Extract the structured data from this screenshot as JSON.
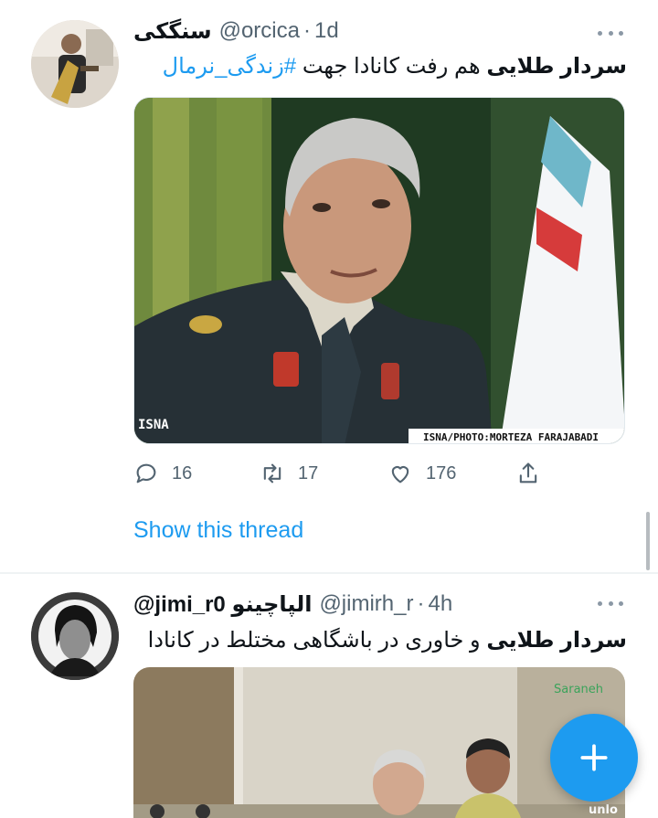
{
  "tweets": [
    {
      "display_name": "سنگکی",
      "handle": "@orcica",
      "separator": "·",
      "time": "1d",
      "text_bold": "سردار طلایی",
      "text_plain": " هم رفت کانادا جهت ",
      "hashtag": "#زندگی_نرمال",
      "media": {
        "watermark_left": "ISNA",
        "watermark_right": "ISNA/PHOTO:MORTEZA FARAJABADI"
      },
      "actions": {
        "reply_count": "16",
        "retweet_count": "17",
        "like_count": "176"
      },
      "show_thread": "Show this thread"
    },
    {
      "display_name": "@jimi_r0 الپاچینو",
      "handle": "@jimirh_r",
      "separator": "·",
      "time": "4h",
      "text_bold": "سردار طلایی",
      "text_plain": " و خاوری در باشگاهی مختلط در کانادا",
      "media": {
        "watermark_top_right": "Saraneh",
        "watermark_bottom_right": "unlo"
      }
    }
  ],
  "icons": {
    "reply": "reply-icon",
    "retweet": "retweet-icon",
    "like": "heart-icon",
    "share": "share-icon",
    "compose": "plus-icon",
    "more": "more-dots-icon"
  },
  "colors": {
    "accent": "#1d9bf0",
    "text": "#0f1419",
    "muted": "#536471",
    "divider": "#eff3f4"
  }
}
